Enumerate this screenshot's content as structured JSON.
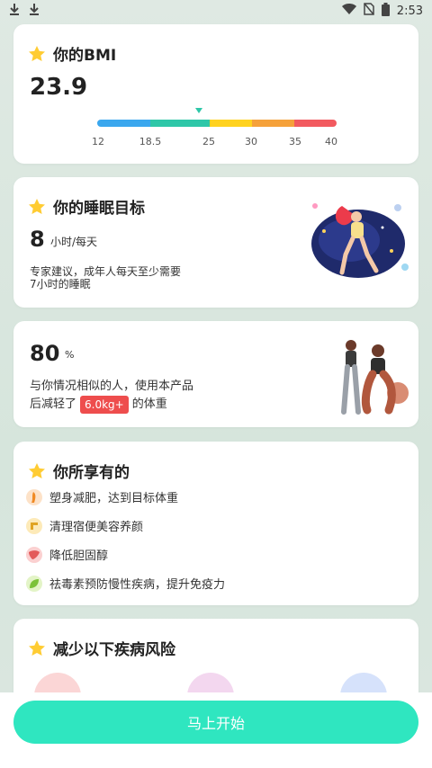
{
  "status_bar": {
    "time": "2:53"
  },
  "bmi": {
    "title": "你的BMI",
    "value": "23.9",
    "value_num": 23.9,
    "ticks": [
      "12",
      "18.5",
      "25",
      "30",
      "35",
      "40"
    ],
    "segment_colors": [
      "#3aa7ee",
      "#2ec7a8",
      "#ffd21f",
      "#f5a13a",
      "#f25a5f"
    ]
  },
  "sleep": {
    "title": "你的睡眠目标",
    "hours": "8",
    "unit": "小时/每天",
    "desc_line1": "专家建议，成年人每天至少需要",
    "desc_line2": "7小时的睡眠"
  },
  "weight": {
    "percent": "80",
    "percent_sign": "%",
    "line1": "与你情况相似的人，使用本产品",
    "line2_prefix": "后减轻了",
    "badge": "6.0kg+",
    "line2_suffix": "的体重"
  },
  "benefits": {
    "title": "你所享有的",
    "items": [
      {
        "label": "塑身减肥，达到目标体重",
        "icon": "body-icon"
      },
      {
        "label": "清理宿便美容养颜",
        "icon": "intestine-icon"
      },
      {
        "label": "降低胆固醇",
        "icon": "liver-icon"
      },
      {
        "label": "祛毒素预防慢性疾病，提升免疫力",
        "icon": "leaf-icon"
      }
    ]
  },
  "risk": {
    "title": "减少以下疾病风险"
  },
  "start_button": "马上开始",
  "colors": {
    "accent": "#2fe6c0",
    "badge": "#ee4d4d",
    "star": "#ffcc33"
  }
}
